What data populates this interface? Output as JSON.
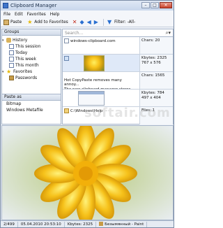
{
  "window": {
    "title": "Clipboard Manager"
  },
  "window_controls": {
    "minimize": "–",
    "maximize": "□",
    "close": "✕"
  },
  "menu": [
    "File",
    "Edit",
    "Favorites",
    "Help"
  ],
  "toolbar": {
    "paste_label": "Paste",
    "add_fav_label": "Add to Favorites",
    "filter_label": "Filter: -All-"
  },
  "groups": {
    "header": "Groups",
    "items": [
      {
        "label": "History",
        "icon": "history-icon"
      },
      {
        "label": "This session",
        "icon": "calendar-icon"
      },
      {
        "label": "Today",
        "icon": "calendar-icon"
      },
      {
        "label": "This week",
        "icon": "calendar-icon"
      },
      {
        "label": "This month",
        "icon": "calendar-icon"
      },
      {
        "label": "Favorites",
        "icon": "star-icon"
      },
      {
        "label": "Passwords",
        "icon": "password-icon"
      }
    ]
  },
  "paste_as": {
    "header": "Paste as",
    "items": [
      "Bitmap",
      "Windows Metafile"
    ]
  },
  "search": {
    "placeholder": "Search..."
  },
  "clips": [
    {
      "text": "windows-clipboard.com",
      "meta": [
        "Chars: 20"
      ]
    },
    {
      "text": "",
      "meta": [
        "Kbytes: 2325",
        "767 x 576"
      ]
    },
    {
      "text": "Hot CopyPaste removes many annoy...\nThe new clipboard manager stores...\nManaging thousands of snippets o...",
      "meta": [
        "Chars: 1565"
      ]
    },
    {
      "text": "",
      "meta": [
        "Kbytes: 784",
        "497 x 404"
      ]
    },
    {
      "text": "C:\\Windows\\Help",
      "meta": [
        "Files: 1"
      ]
    }
  ],
  "status": {
    "count": "2/499",
    "datetime": "05.04.2010 20:53:10",
    "size": "Kbytes: 2325",
    "source": "Безымянный - Paint"
  },
  "watermark": "softair.com"
}
